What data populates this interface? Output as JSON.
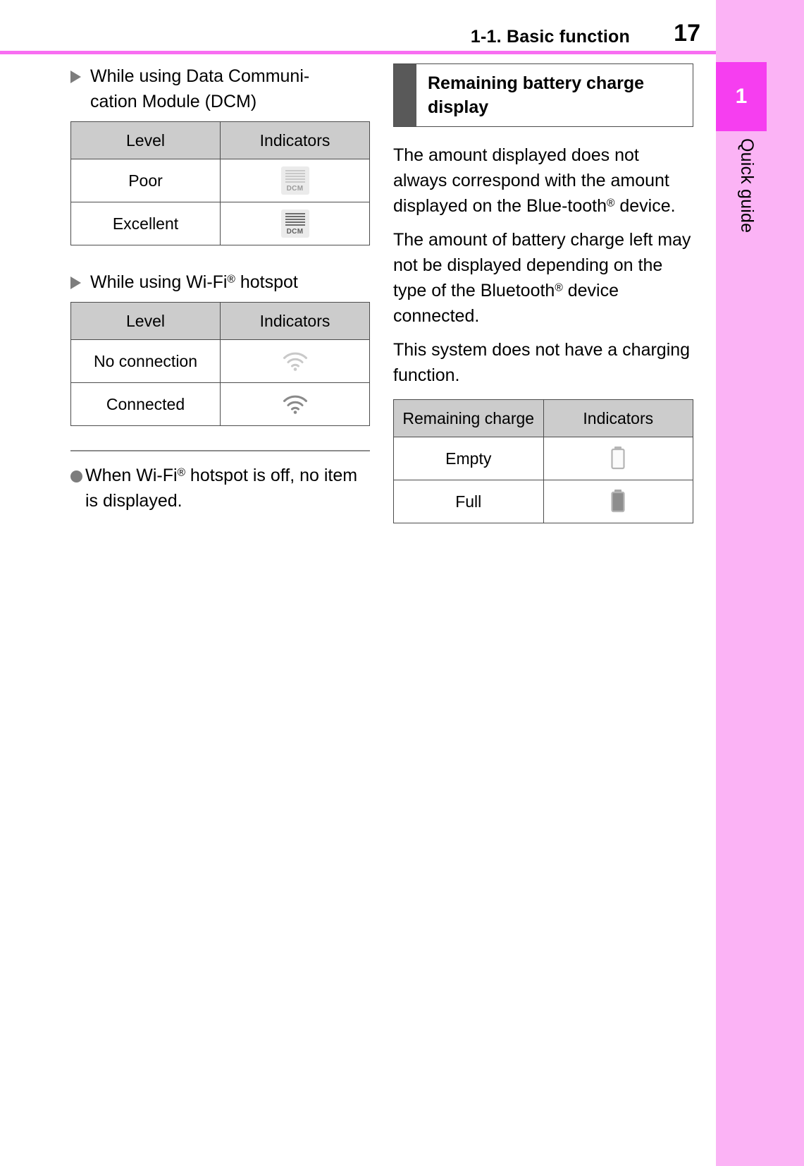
{
  "header": {
    "section_title": "1-1. Basic function",
    "page_number": "17"
  },
  "tab_strip": {
    "chapter_number": "1",
    "chapter_label": "Quick guide",
    "tab_color": "#f63ef0",
    "strip_color": "#fbb3f5",
    "rule_color": "#f86ef2"
  },
  "left_column": {
    "dcm_section": {
      "heading_part1": "While using Data Communi-",
      "heading_part2": "cation Module (DCM)",
      "table": {
        "headers": [
          "Level",
          "Indicators"
        ],
        "rows": [
          {
            "level": "Poor",
            "icon": "dcm-weak-icon"
          },
          {
            "level": "Excellent",
            "icon": "dcm-strong-icon"
          }
        ]
      }
    },
    "wifi_section": {
      "heading_pre": "While using Wi-Fi",
      "heading_sup": "®",
      "heading_post": " hotspot",
      "table": {
        "headers": [
          "Level",
          "Indicators"
        ],
        "rows": [
          {
            "level": "No connection",
            "icon": "wifi-weak-icon"
          },
          {
            "level": "Connected",
            "icon": "wifi-strong-icon"
          }
        ]
      }
    },
    "note": {
      "pre": "When Wi-Fi",
      "sup": "®",
      "post": " hotspot is off, no item is displayed."
    }
  },
  "right_column": {
    "heading_line1": "Remaining battery charge",
    "heading_line2": "display",
    "paragraphs": [
      {
        "pre": "The amount displayed does not always correspond with the amount displayed on the Blue-tooth",
        "sup": "®",
        "post": " device."
      },
      {
        "pre": "The amount of battery charge left may not be displayed depending on the type of the Bluetooth",
        "sup": "®",
        "post": " device connected."
      },
      {
        "pre": "This system does not have a charging function.",
        "sup": "",
        "post": ""
      }
    ],
    "table": {
      "headers": [
        "Remaining charge",
        "Indicators"
      ],
      "rows": [
        {
          "charge": "Empty",
          "icon": "battery-empty-icon"
        },
        {
          "charge": "Full",
          "icon": "battery-full-icon"
        }
      ]
    }
  }
}
